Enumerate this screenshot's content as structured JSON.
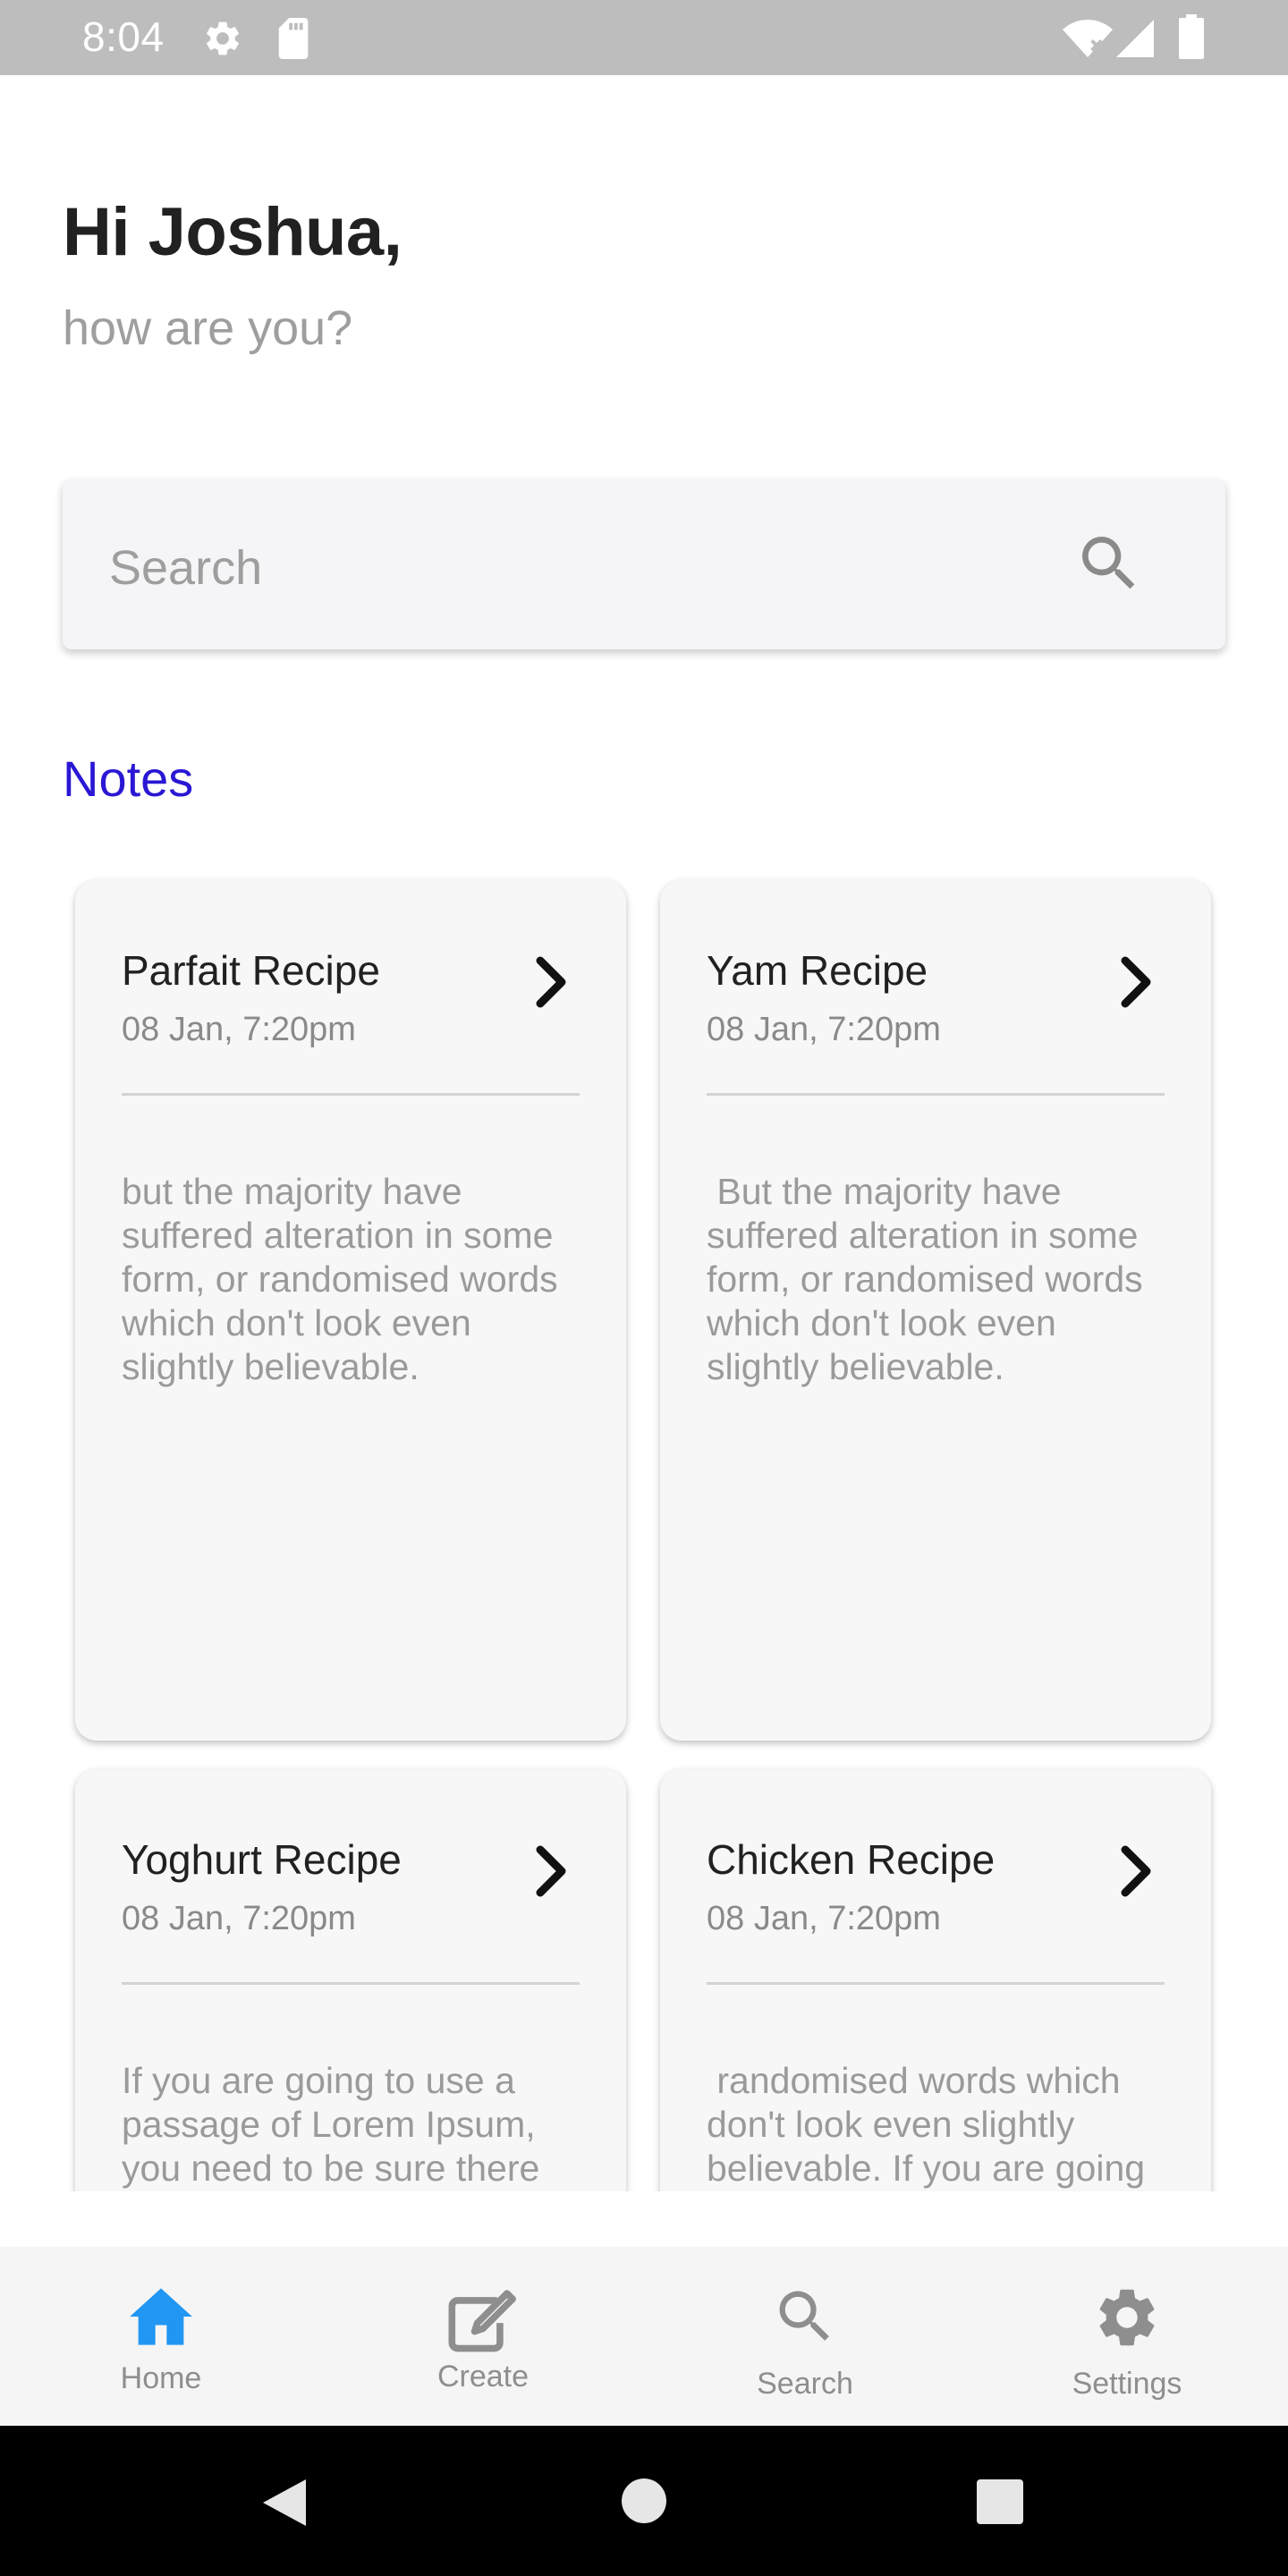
{
  "status_bar": {
    "time": "8:04",
    "icons": [
      "settings-icon",
      "sd-card-icon",
      "wifi-icon",
      "signal-icon",
      "battery-icon"
    ]
  },
  "greeting": {
    "title": "Hi Joshua,",
    "subtitle": "how are you?"
  },
  "search": {
    "placeholder": "Search",
    "icon": "search-icon"
  },
  "section": {
    "title": "Notes"
  },
  "notes": [
    {
      "title": "Parfait Recipe",
      "date": "08 Jan, 7:20pm",
      "body": "but the majority have suffered alteration in some form, or randomised words which don't look even slightly believable."
    },
    {
      "title": "Yam Recipe",
      "date": "08 Jan, 7:20pm",
      "body": " But the majority have suffered alteration in some form, or randomised words which don't look even slightly believable."
    },
    {
      "title": "Yoghurt Recipe",
      "date": "08 Jan, 7:20pm",
      "body": "If you are going to use a passage of Lorem Ipsum, you need to be sure there isn't anything"
    },
    {
      "title": "Chicken Recipe",
      "date": "08 Jan, 7:20pm",
      "body": " randomised words which don't look even slightly believable. If you are going to use a passage of Lorem"
    }
  ],
  "bottom_nav": {
    "items": [
      {
        "label": "Home",
        "icon": "home-icon",
        "active": true
      },
      {
        "label": "Create",
        "icon": "edit-icon",
        "active": false
      },
      {
        "label": "Search",
        "icon": "search-icon",
        "active": false
      },
      {
        "label": "Settings",
        "icon": "gear-icon",
        "active": false
      }
    ]
  },
  "colors": {
    "accent_active": "#2196f3",
    "section_title": "#2a17d4",
    "nav_inactive": "#8e8e8e",
    "status_bar": "#bdbdbd"
  }
}
